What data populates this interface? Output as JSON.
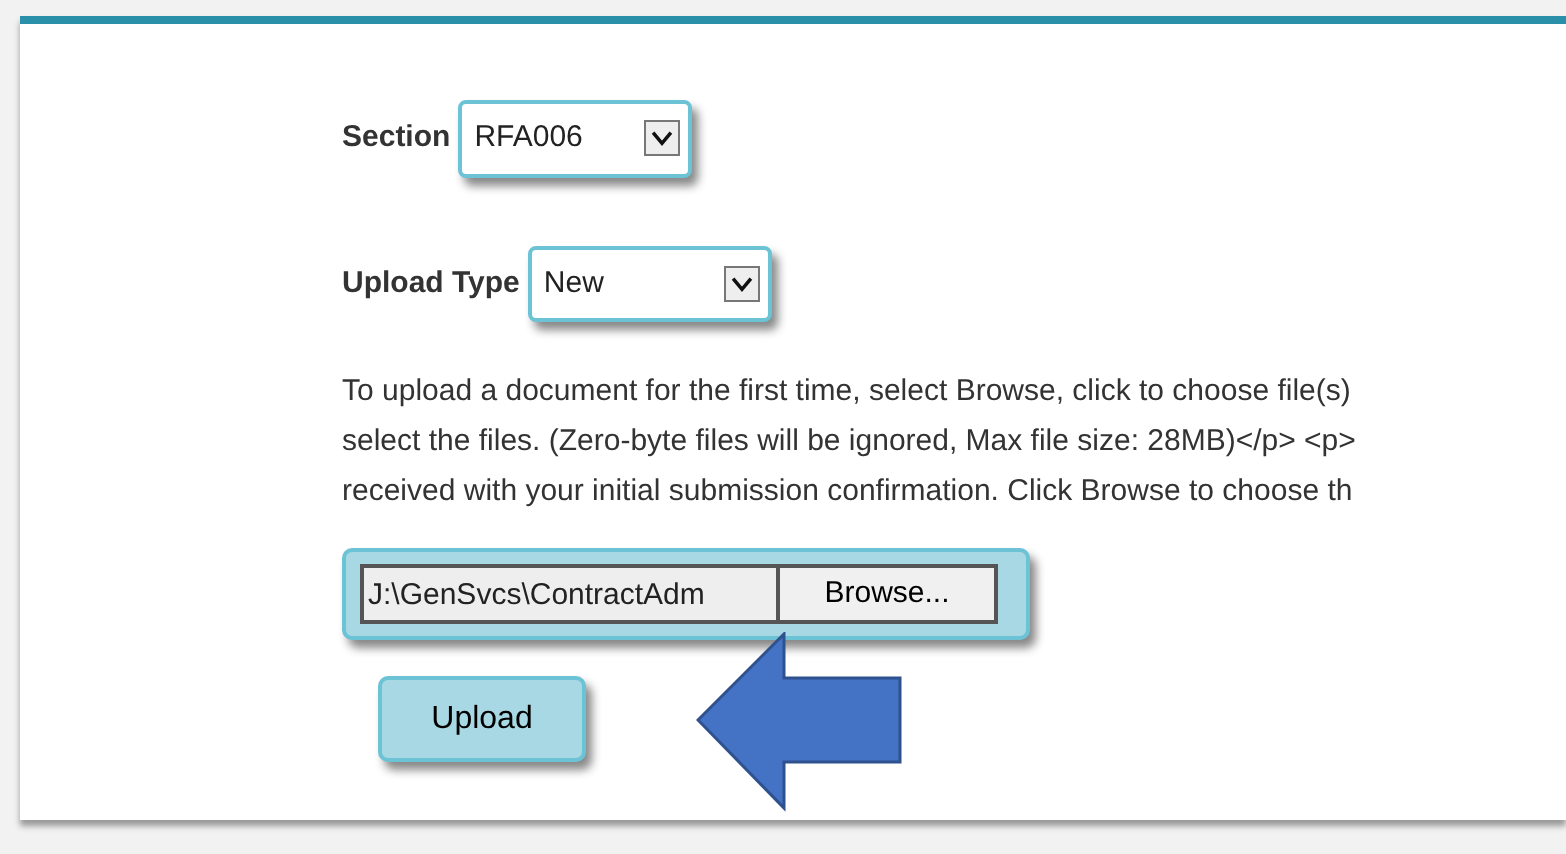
{
  "section": {
    "label": "Section",
    "value": "RFA006"
  },
  "upload_type": {
    "label": "Upload Type",
    "value": "New"
  },
  "instructions": [
    "To upload a document for the first time, select Browse, click to choose file(s)",
    "select the files. (Zero-byte files will be ignored, Max file size: 28MB)</p> <p>",
    "received with your initial submission confirmation. Click Browse to choose th"
  ],
  "file_field": {
    "value": "J:\\GenSvcs\\ContractAdm",
    "button": "Browse..."
  },
  "upload_button": "Upload"
}
